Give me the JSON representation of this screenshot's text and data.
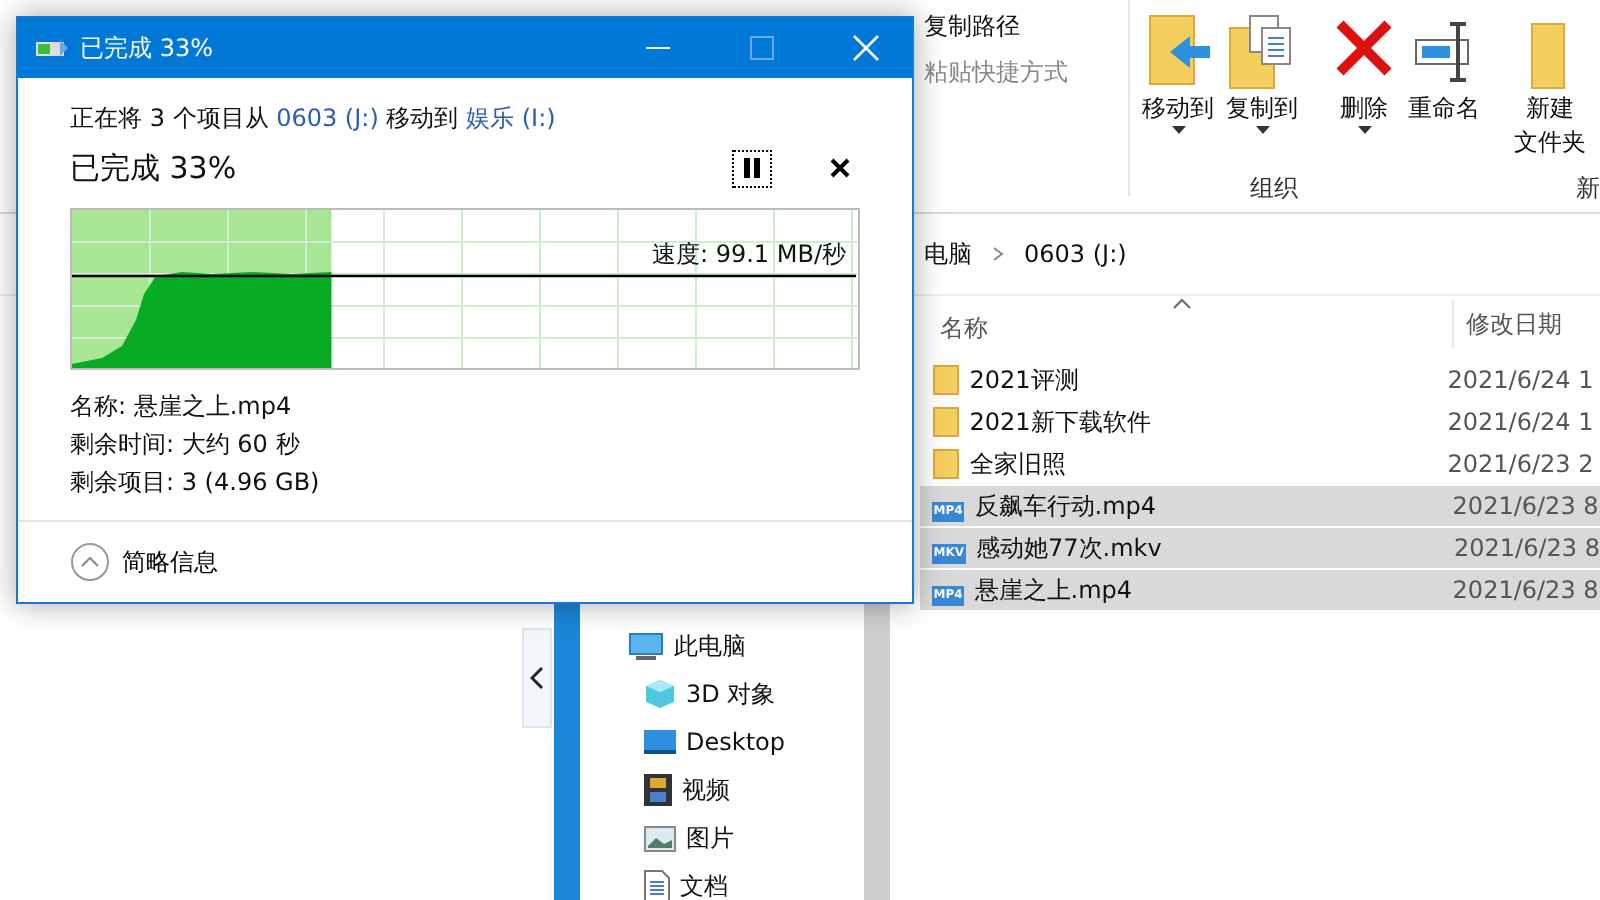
{
  "explorer": {
    "ribbon": {
      "small_items": [
        {
          "label": "复制路径",
          "disabled": false
        },
        {
          "label": "粘贴快捷方式",
          "disabled": true
        }
      ],
      "big_buttons": [
        {
          "kind": "move",
          "label": "移动到",
          "dropdown": true
        },
        {
          "kind": "copy",
          "label": "复制到",
          "dropdown": true
        },
        {
          "kind": "delete",
          "label": "删除",
          "dropdown": true
        },
        {
          "kind": "rename",
          "label": "重命名",
          "dropdown": false
        },
        {
          "kind": "newfolder",
          "label_lines": [
            "新建",
            "文件夹"
          ],
          "dropdown": false
        }
      ],
      "group_labels": [
        "组织",
        "新"
      ]
    },
    "breadcrumb": [
      "电脑",
      "0603 (J:)"
    ],
    "columns": [
      "名称",
      "修改日期"
    ],
    "files": [
      {
        "kind": "folder",
        "name": "2021评测",
        "date": "2021/6/24 1",
        "selected": false
      },
      {
        "kind": "folder",
        "name": "2021新下载软件",
        "date": "2021/6/24 1",
        "selected": false
      },
      {
        "kind": "folder",
        "name": "全家旧照",
        "date": "2021/6/23 2",
        "selected": false
      },
      {
        "kind": "video",
        "badge": "MP4",
        "name": "反飙车行动.mp4",
        "date": "2021/6/23 8",
        "selected": true
      },
      {
        "kind": "video",
        "badge": "MKV",
        "name": "感动她77次.mkv",
        "date": "2021/6/23 8",
        "selected": true
      },
      {
        "kind": "video",
        "badge": "MP4",
        "name": "悬崖之上.mp4",
        "date": "2021/6/23 8",
        "selected": true
      }
    ],
    "nav": {
      "label": "此电脑",
      "children": [
        {
          "kind": "objects",
          "label": "3D 对象"
        },
        {
          "kind": "desktop",
          "label": "Desktop"
        },
        {
          "kind": "video",
          "label": "视频"
        },
        {
          "kind": "pictures",
          "label": "图片"
        },
        {
          "kind": "documents",
          "label": "文档"
        }
      ]
    }
  },
  "dialog": {
    "title": "已完成 33%",
    "move_text": {
      "prefix": "正在将 3 个项目从",
      "source": "0603 (J:)",
      "middle": "移动到",
      "destination": "娱乐 (I:)"
    },
    "heading": "已完成 33%",
    "progress": {
      "level": 0.33,
      "speed": "速度: 99.1 MB/秒"
    },
    "details": [
      "名称: 悬崖之上.mp4",
      "剩余时间: 大约 60 秒",
      "剩余项目: 3 (4.96 GB)"
    ],
    "toggle": "简略信息"
  }
}
